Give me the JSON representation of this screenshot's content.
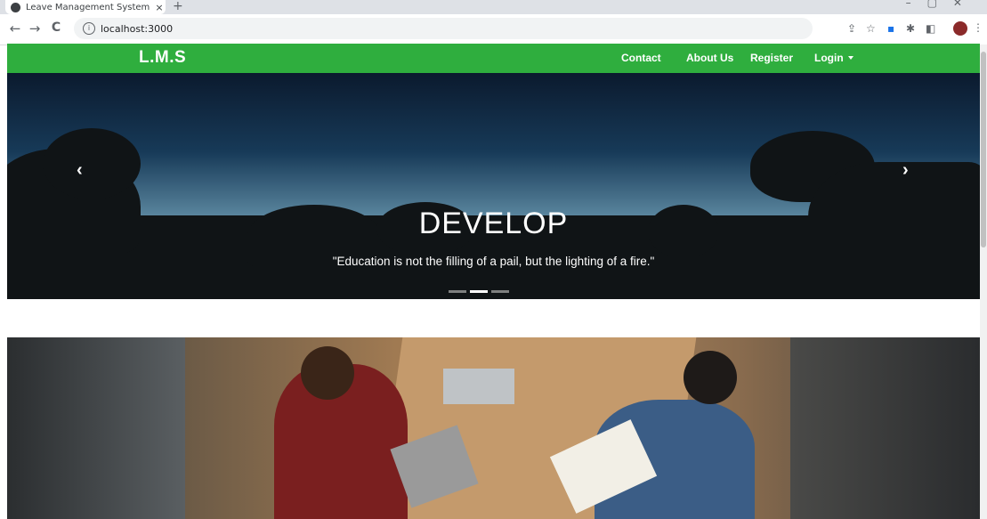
{
  "browser": {
    "tab_title": "Leave Management System",
    "tab_close": "×",
    "new_tab": "+",
    "back": "←",
    "forward": "→",
    "reload": "C",
    "url": "localhost:3000",
    "info": "i"
  },
  "navbar": {
    "brand": "L.M.S",
    "links": [
      "Contact",
      "About Us",
      "Register"
    ],
    "login": "Login"
  },
  "hero": {
    "title": "DEVELOP",
    "quote": "\"Education is not the filling of a pail, but the lighting of a fire.\"",
    "prev": "‹",
    "next": "›",
    "active_slide_index": 1,
    "slide_count": 3
  },
  "colors": {
    "navbar": "#2fae3e",
    "text_on_navbar": "#ffffff"
  }
}
